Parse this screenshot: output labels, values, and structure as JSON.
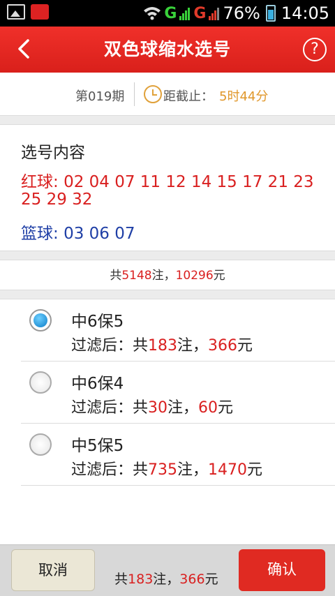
{
  "status_bar": {
    "network_1": "G",
    "network_2": "G",
    "battery": "76%",
    "time": "14:05",
    "icons": [
      "image-icon",
      "app-notification-icon",
      "wifi-icon",
      "signal-icon",
      "battery-icon"
    ]
  },
  "header": {
    "title": "双色球缩水选号",
    "help": "?",
    "back_icon": "chevron-left-icon",
    "bg_color": "#e6241f"
  },
  "period": {
    "number": "第019期",
    "deadline_label": "距截止：",
    "deadline_value": "5时44分"
  },
  "content": {
    "title": "选号内容",
    "red_label": "红球:",
    "red_line1": "02 04 07 11 12 14 15 17 21 23",
    "red_line2": "25 29 32",
    "blue_label": "篮球:",
    "blue_numbers": "03 06 07"
  },
  "total": {
    "prefix": "共",
    "bets": "5148",
    "mid": "注，",
    "amount": "10296",
    "suffix": "元"
  },
  "options": [
    {
      "name": "中6保5",
      "selected": true,
      "filter_label": "过滤后：共",
      "bets": "183",
      "mid": "注，",
      "amount": "366",
      "suffix": "元"
    },
    {
      "name": "中6保4",
      "selected": false,
      "filter_label": "过滤后：共",
      "bets": "30",
      "mid": "注，",
      "amount": "60",
      "suffix": "元"
    },
    {
      "name": "中5保5",
      "selected": false,
      "filter_label": "过滤后：共",
      "bets": "735",
      "mid": "注，",
      "amount": "1470",
      "suffix": "元"
    }
  ],
  "bottom": {
    "cancel": "取消",
    "prefix": "共",
    "bets": "183",
    "mid": "注，",
    "amount": "366",
    "suffix": "元",
    "confirm": "确认"
  }
}
